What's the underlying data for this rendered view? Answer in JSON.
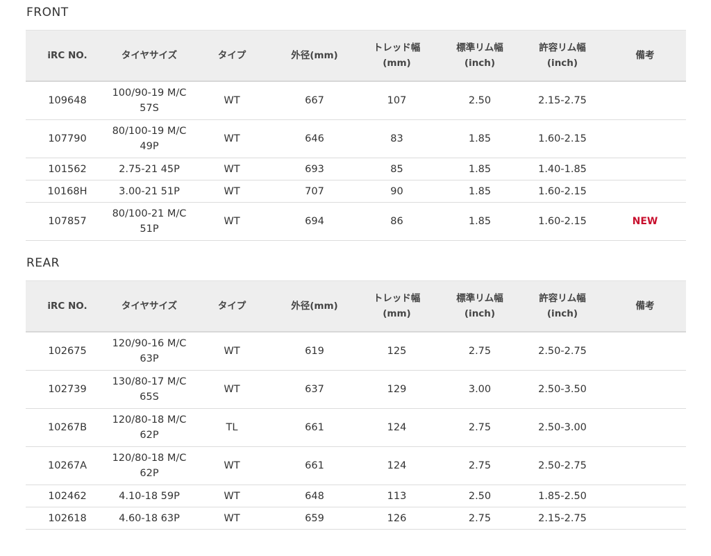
{
  "headers": {
    "irc_no": "iRC NO.",
    "tire_size": "タイヤサイズ",
    "type": "タイプ",
    "outer_diameter": "外径(mm)",
    "tread_width_line1": "トレッド幅",
    "tread_width_line2": "(mm)",
    "std_rim_line1": "標準リム幅",
    "std_rim_line2": "(inch)",
    "allowed_rim_line1": "許容リム幅",
    "allowed_rim_line2": "(inch)",
    "notes": "備考"
  },
  "colors": {
    "header_bg": "#eeeeee",
    "new_badge": "#c8102e"
  },
  "front": {
    "title": "FRONT",
    "rows": [
      {
        "irc_no": "109648",
        "size_line1": "100/90-19 M/C",
        "size_line2": "57S",
        "type": "WT",
        "outer": "667",
        "tread": "107",
        "std_rim": "2.50",
        "allowed_rim": "2.15-2.75",
        "note": ""
      },
      {
        "irc_no": "107790",
        "size_line1": "80/100-19 M/C",
        "size_line2": "49P",
        "type": "WT",
        "outer": "646",
        "tread": "83",
        "std_rim": "1.85",
        "allowed_rim": "1.60-2.15",
        "note": ""
      },
      {
        "irc_no": "101562",
        "size_line1": "2.75-21 45P",
        "size_line2": "",
        "type": "WT",
        "outer": "693",
        "tread": "85",
        "std_rim": "1.85",
        "allowed_rim": "1.40-1.85",
        "note": ""
      },
      {
        "irc_no": "10168H",
        "size_line1": "3.00-21 51P",
        "size_line2": "",
        "type": "WT",
        "outer": "707",
        "tread": "90",
        "std_rim": "1.85",
        "allowed_rim": "1.60-2.15",
        "note": ""
      },
      {
        "irc_no": "107857",
        "size_line1": "80/100-21 M/C",
        "size_line2": "51P",
        "type": "WT",
        "outer": "694",
        "tread": "86",
        "std_rim": "1.85",
        "allowed_rim": "1.60-2.15",
        "note": "NEW"
      }
    ]
  },
  "rear": {
    "title": "REAR",
    "rows": [
      {
        "irc_no": "102675",
        "size_line1": "120/90-16 M/C",
        "size_line2": "63P",
        "type": "WT",
        "outer": "619",
        "tread": "125",
        "std_rim": "2.75",
        "allowed_rim": "2.50-2.75",
        "note": ""
      },
      {
        "irc_no": "102739",
        "size_line1": "130/80-17 M/C",
        "size_line2": "65S",
        "type": "WT",
        "outer": "637",
        "tread": "129",
        "std_rim": "3.00",
        "allowed_rim": "2.50-3.50",
        "note": ""
      },
      {
        "irc_no": "10267B",
        "size_line1": "120/80-18 M/C",
        "size_line2": "62P",
        "type": "TL",
        "outer": "661",
        "tread": "124",
        "std_rim": "2.75",
        "allowed_rim": "2.50-3.00",
        "note": ""
      },
      {
        "irc_no": "10267A",
        "size_line1": "120/80-18 M/C",
        "size_line2": "62P",
        "type": "WT",
        "outer": "661",
        "tread": "124",
        "std_rim": "2.75",
        "allowed_rim": "2.50-2.75",
        "note": ""
      },
      {
        "irc_no": "102462",
        "size_line1": "4.10-18 59P",
        "size_line2": "",
        "type": "WT",
        "outer": "648",
        "tread": "113",
        "std_rim": "2.50",
        "allowed_rim": "1.85-2.50",
        "note": ""
      },
      {
        "irc_no": "102618",
        "size_line1": "4.60-18 63P",
        "size_line2": "",
        "type": "WT",
        "outer": "659",
        "tread": "126",
        "std_rim": "2.75",
        "allowed_rim": "2.15-2.75",
        "note": ""
      }
    ]
  }
}
